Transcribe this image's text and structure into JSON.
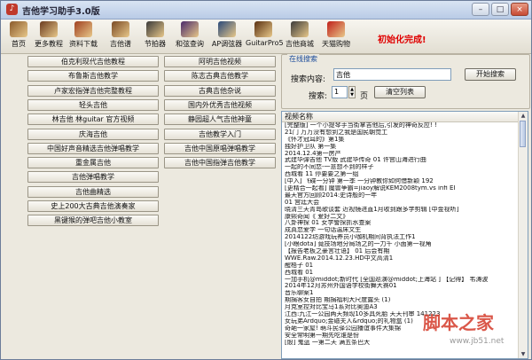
{
  "window": {
    "title": "吉他学习助手3.0版",
    "minimize": "–",
    "maximize": "□",
    "close": "×"
  },
  "toolbar": {
    "items": [
      {
        "label": "首页",
        "icon": "home-icon",
        "color": "#8b5a2b"
      },
      {
        "label": "更多教程",
        "icon": "guitar-icon",
        "color": "#6b3b1f"
      },
      {
        "label": "资料下载",
        "icon": "guitar-download-icon",
        "color": "#a04020"
      },
      {
        "label": "吉他谱",
        "icon": "guitar-score-icon",
        "color": "#7a4a24"
      },
      {
        "label": "节拍器",
        "icon": "metronome-icon",
        "color": "#3a3a3a"
      },
      {
        "label": "和弦查询",
        "icon": "chord-icon",
        "color": "#4a2a6a"
      },
      {
        "label": "AP调弦器",
        "icon": "tuner-icon",
        "color": "#2a4a7a"
      },
      {
        "label": "GuitarPro5",
        "icon": "guitarpro-icon",
        "color": "#5a3010"
      },
      {
        "label": "吉他商城",
        "icon": "shop-icon",
        "color": "#3b3b3b"
      },
      {
        "label": "天猫购物",
        "icon": "tmall-icon",
        "color": "#c0201a"
      }
    ],
    "status": "初始化完成!"
  },
  "left": {
    "column1": [
      "伯克利现代吉他教程",
      "布鲁斯吉他教学",
      "卢家宏指弹吉他完整教程",
      "轻头吉他",
      "林吉他 林guitar 官方视频",
      "庆海吉他",
      "中国好声音精选吉他弹唱教学",
      "重金属吉他",
      "吉他弹唱教学",
      "吉他曲精选",
      "史上200大古典吉他演奏家",
      "黑键猴的弹吧吉他小教室"
    ],
    "column2": [
      "阿明吉他视频",
      "陈志古典吉他教学",
      "古典吉他杂说",
      "国内外优秀吉他视频",
      "静园超人气吉他神童",
      "吉他教学入门",
      "吉他中国原唱弹唱教学",
      "吉他中国指弹吉他教学"
    ]
  },
  "search": {
    "legend": "在线搜索",
    "keyword_label": "搜索内容:",
    "keyword_value": "吉他",
    "search_button": "开始搜索",
    "page_label": "搜索:",
    "page_value": "1",
    "page_unit": "页",
    "clear_button": "清空列表"
  },
  "results": {
    "header": "视频名称",
    "rows": [
      "[完整版] 一个小提琴手当街拿吉他后,引发的神奇反应! !",
      "21门 万万没有想到之我是国民朝觉工",
      "《怀才冠耳的》第1集",
      "独好护卫队 第一集",
      "2014.12.4第一房产",
      "武建华弹吉他 TV版 武建华传奇 01 许宫山海进行曲",
      "一起的不同恋-一意想不到的样子",
      "西城看 11 停要要之第一组",
      "[中入] 飞碟一分钟 第一季 一分钟教你如何借新颖 192",
      "[更精合一起看] 魔兽争霸=jiaoy解说KEM2008tym.vs infi EI",
      "最天官方回顾2014:史诗般的一年",
      "01 宫廷大会",
      "晓清三天青岛歌谈套 近视镜进直1月收到跟多学剪辑 [中金视听]",
      "康熙奇闻《 爱好二文》",
      "八卦神探 01 女学警探抓水查案",
      "成真恋爱学 一句话温床文生",
      "2014122坊游戏玩养员小咖机期间背执法工作1",
      "[小眼dota] 竟技场地分局场之的一力千 小面第一视角",
      "【报告老板之豪言壮语】 01 后会有期",
      "WWE.Raw.2014.12.23.HD中文高清1",
      "醒梧子 01",
      "西城看 01",
      "一加手机@middot;新时代 [全国巡演@middot;上海站 ] 【记得】 韦涛波",
      "2014年12月苏州外国语学校街舞大赛01",
      "音乐聊案1",
      "期捐客女自拍 期捐福利大尺度露头 (1)",
      "月克室控对比宝马1系对比奥迪A3",
      "江西:九江一公园两天频现10多具死胎 天天刊审 141223",
      "女玩弟Ardquo;金磁夫人&rdquo;的礼物盒 (1)",
      "奇葩一家屋! 萌斗民驿公园播谊事件大集锦",
      "安全常明第一期先吃谁是份",
      "[骰] 鬼蓝 一第二天 满五条巴大"
    ]
  },
  "watermark": {
    "logo": "脚本之家",
    "url": "www.jb51.net"
  }
}
